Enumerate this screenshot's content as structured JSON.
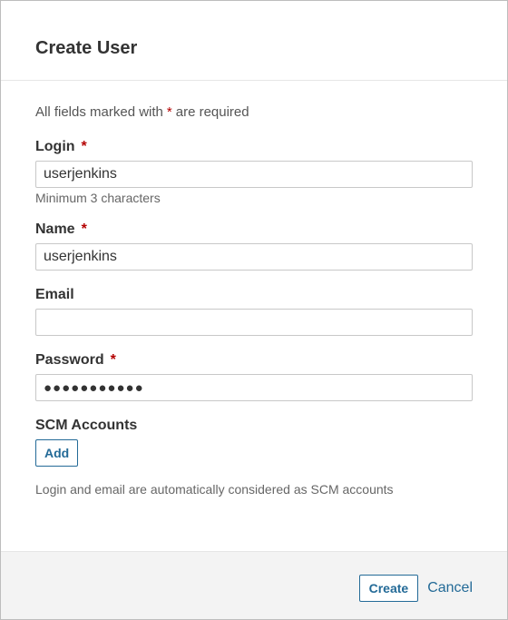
{
  "dialog": {
    "title": "Create User"
  },
  "form": {
    "required_note_prefix": "All fields marked with",
    "required_marker": "*",
    "required_note_suffix": "are required",
    "login": {
      "label": "Login",
      "value": "userjenkins",
      "hint": "Minimum 3 characters"
    },
    "name": {
      "label": "Name",
      "value": "userjenkins"
    },
    "email": {
      "label": "Email",
      "value": ""
    },
    "password": {
      "label": "Password",
      "value": "●●●●●●●●●●●"
    },
    "scm": {
      "label": "SCM Accounts",
      "add_label": "Add",
      "hint": "Login and email are automatically considered as SCM accounts"
    }
  },
  "footer": {
    "create_label": "Create",
    "cancel_label": "Cancel"
  },
  "colors": {
    "required": "#b40000",
    "link": "#236a97",
    "footer_bg": "#f3f3f3"
  }
}
